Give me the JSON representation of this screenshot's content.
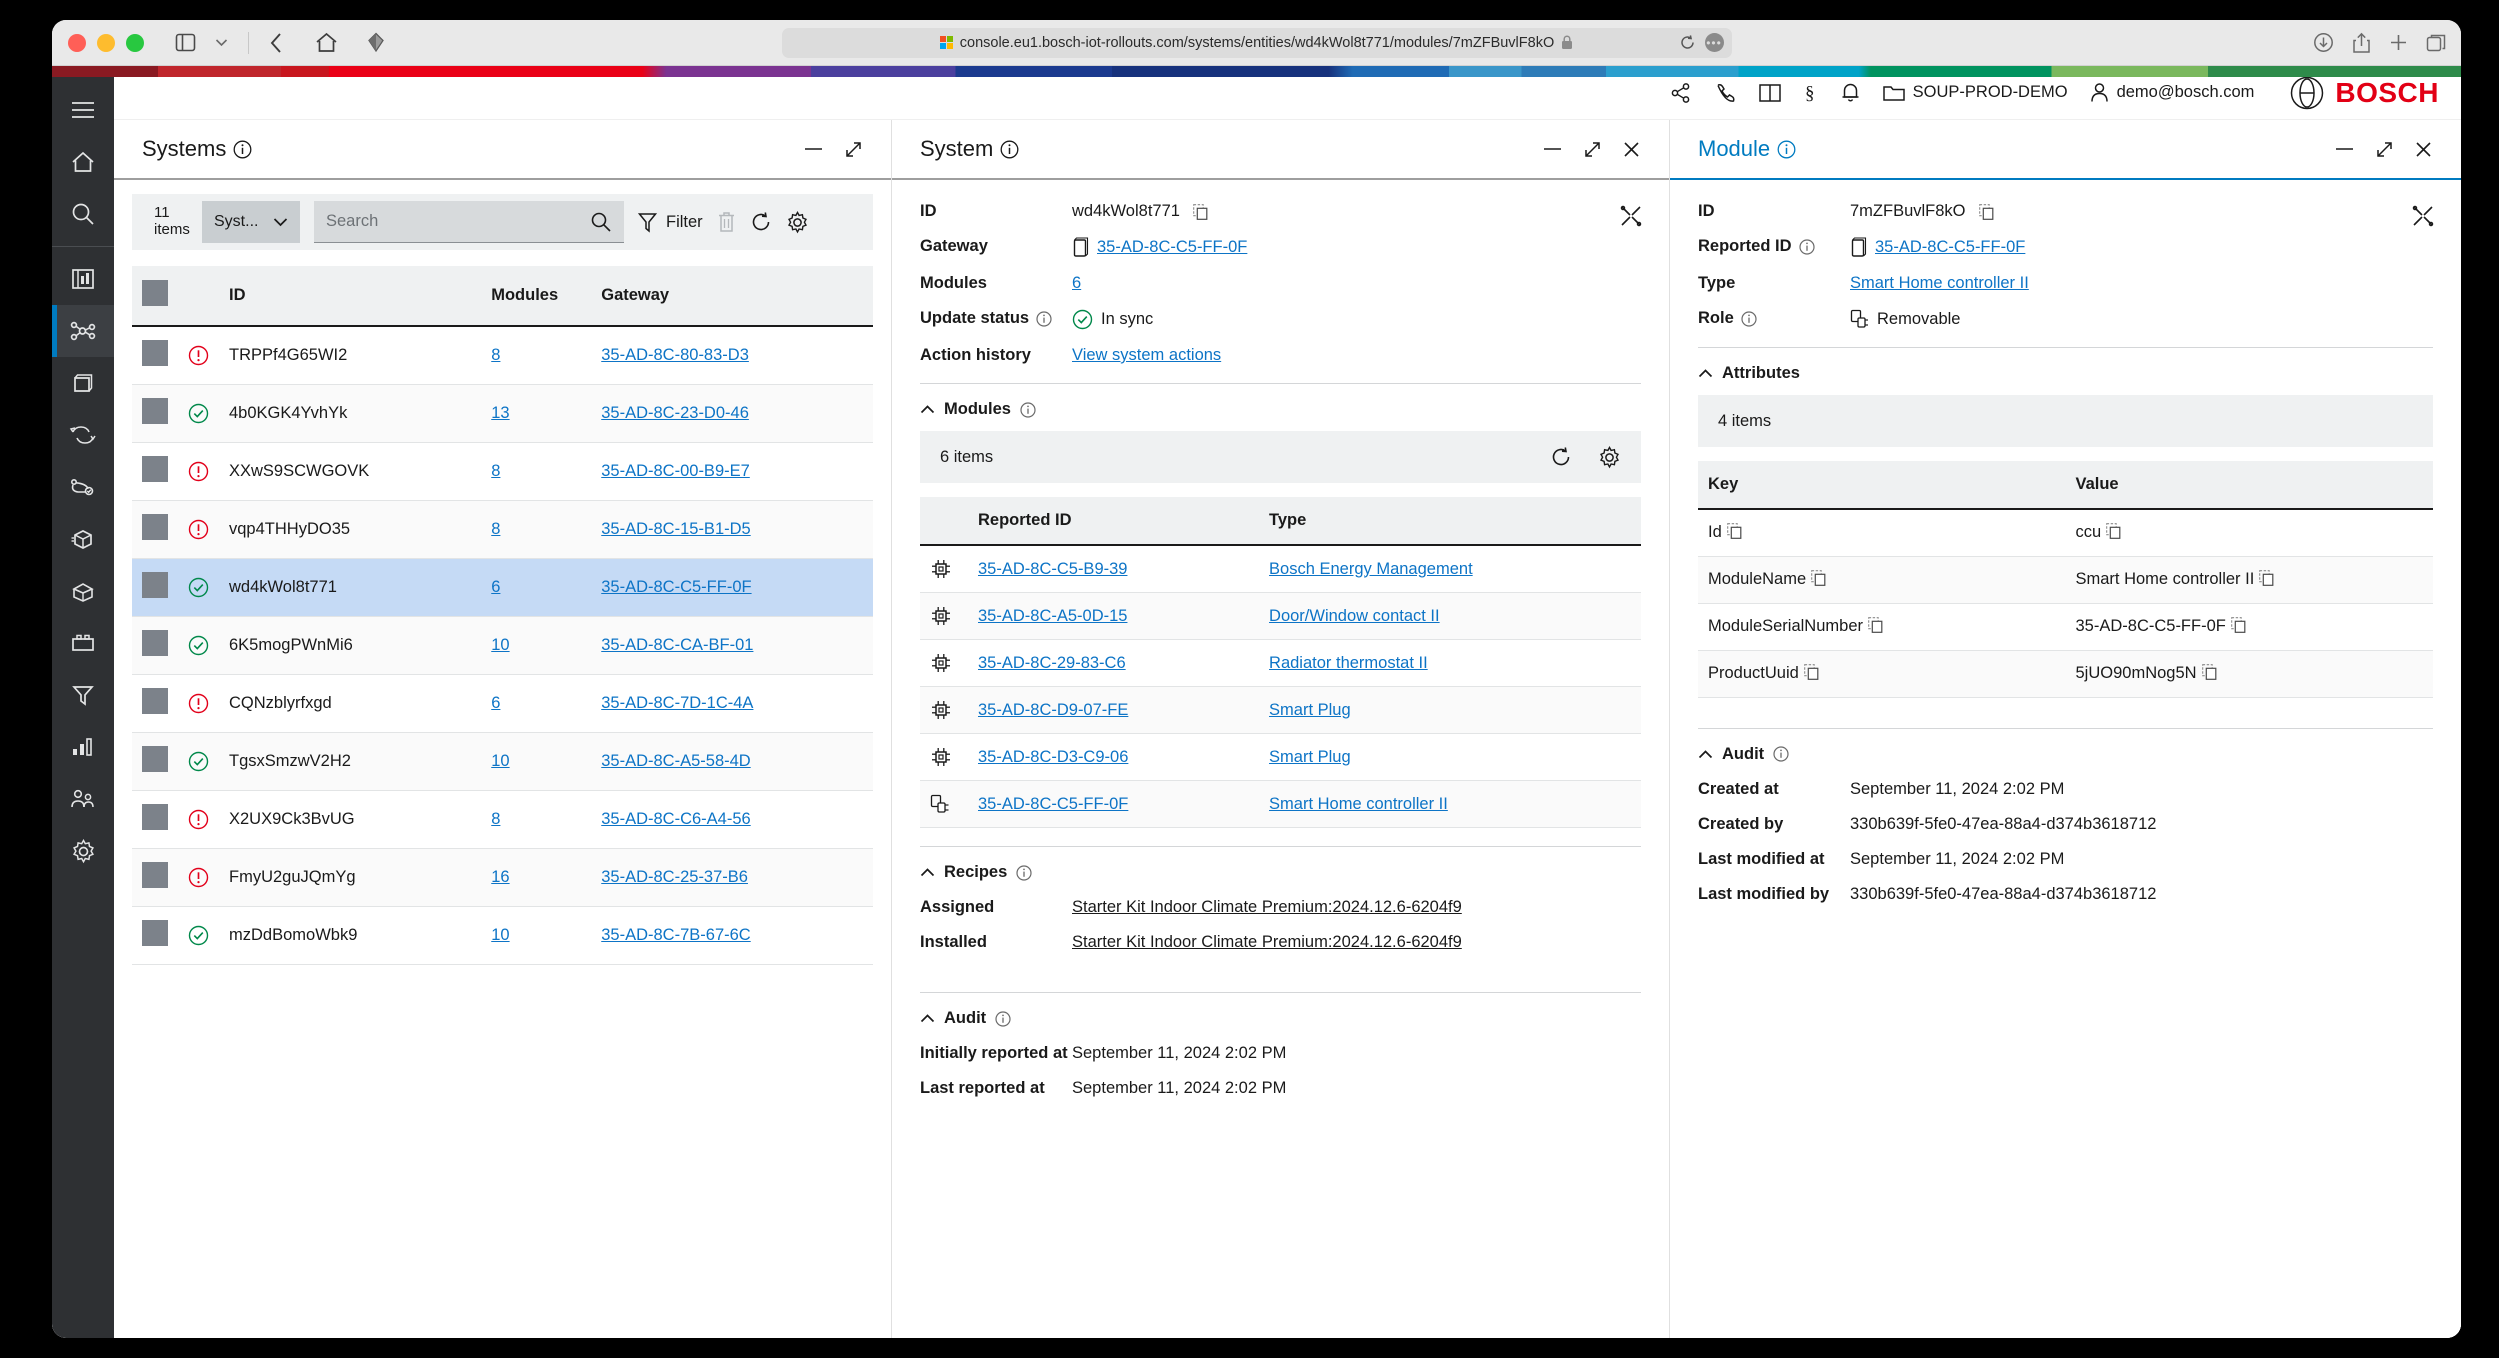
{
  "browser": {
    "url": "console.eu1.bosch-iot-rollouts.com/systems/entities/wd4kWol8t771/modules/7mZFBuvlF8kO",
    "lock_icon": "lock-icon",
    "back_icon": "back-icon",
    "home_icon": "home-icon",
    "sidebar_icon": "sidebar-toggle-icon",
    "extension_icon": "extension-icon",
    "reload_icon": "reload-icon",
    "more_icon": "more-icon",
    "download_icon": "download-icon",
    "share_icon": "share-icon",
    "newtab_icon": "new-tab-icon",
    "tabs_icon": "tab-overview-icon"
  },
  "rail": {
    "items": [
      {
        "icon": "hamburger-menu-icon",
        "name": "sidebar-item-menu"
      },
      {
        "icon": "home-icon",
        "name": "sidebar-item-home"
      },
      {
        "icon": "search-icon",
        "name": "sidebar-item-search"
      },
      {
        "icon": "dashboard-icon",
        "name": "sidebar-item-dashboard"
      },
      {
        "icon": "network-systems-icon",
        "name": "sidebar-item-systems"
      },
      {
        "icon": "device-icon",
        "name": "sidebar-item-devices"
      },
      {
        "icon": "sync-icon",
        "name": "sidebar-item-rollouts"
      },
      {
        "icon": "deployment-icon",
        "name": "sidebar-item-deployments"
      },
      {
        "icon": "package-icon",
        "name": "sidebar-item-packages"
      },
      {
        "icon": "open-package-icon",
        "name": "sidebar-item-software"
      },
      {
        "icon": "module-board-icon",
        "name": "sidebar-item-modules"
      },
      {
        "icon": "filter-icon",
        "name": "sidebar-item-filters"
      },
      {
        "icon": "chart-icon",
        "name": "sidebar-item-reports"
      },
      {
        "icon": "users-icon",
        "name": "sidebar-item-users"
      },
      {
        "icon": "gear-icon",
        "name": "sidebar-item-settings"
      }
    ]
  },
  "topbar": {
    "tenant": "SOUP-PROD-DEMO",
    "user": "demo@bosch.com",
    "brand": "BOSCH",
    "icons": [
      "share-icon",
      "phone-icon",
      "book-icon",
      "legal-icon",
      "bell-icon"
    ]
  },
  "systems_panel": {
    "title": "Systems",
    "minimize_label": "—",
    "items_count": "11 items",
    "type_select": "Syst...",
    "search_placeholder": "Search",
    "search_value": "",
    "filter_label": "Filter",
    "columns": [
      "ID",
      "Modules",
      "Gateway"
    ],
    "rows": [
      {
        "status": "error",
        "id": "TRPPf4G65WI2",
        "modules": "8",
        "gateway": "35-AD-8C-80-83-D3",
        "selected": false
      },
      {
        "status": "ok",
        "id": "4b0KGK4YvhYk",
        "modules": "13",
        "gateway": "35-AD-8C-23-D0-46",
        "selected": false
      },
      {
        "status": "error",
        "id": "XXwS9SCWGOVK",
        "modules": "8",
        "gateway": "35-AD-8C-00-B9-E7",
        "selected": false
      },
      {
        "status": "error",
        "id": "vqp4THHyDO35",
        "modules": "8",
        "gateway": "35-AD-8C-15-B1-D5",
        "selected": false
      },
      {
        "status": "ok",
        "id": "wd4kWol8t771",
        "modules": "6",
        "gateway": "35-AD-8C-C5-FF-0F",
        "selected": true
      },
      {
        "status": "ok",
        "id": "6K5mogPWnMi6",
        "modules": "10",
        "gateway": "35-AD-8C-CA-BF-01",
        "selected": false
      },
      {
        "status": "error",
        "id": "CQNzblyrfxgd",
        "modules": "6",
        "gateway": "35-AD-8C-7D-1C-4A",
        "selected": false
      },
      {
        "status": "ok",
        "id": "TgsxSmzwV2H2",
        "modules": "10",
        "gateway": "35-AD-8C-A5-58-4D",
        "selected": false
      },
      {
        "status": "error",
        "id": "X2UX9Ck3BvUG",
        "modules": "8",
        "gateway": "35-AD-8C-C6-A4-56",
        "selected": false
      },
      {
        "status": "error",
        "id": "FmyU2guJQmYg",
        "modules": "16",
        "gateway": "35-AD-8C-25-37-B6",
        "selected": false
      },
      {
        "status": "ok",
        "id": "mzDdBomoWbk9",
        "modules": "10",
        "gateway": "35-AD-8C-7B-67-6C",
        "selected": false
      }
    ]
  },
  "system_panel": {
    "title": "System",
    "fields": {
      "id_label": "ID",
      "id_value": "wd4kWol8t771",
      "gateway_label": "Gateway",
      "gateway_value": "35-AD-8C-C5-FF-0F",
      "modules_label": "Modules",
      "modules_value": "6",
      "update_status_label": "Update status",
      "update_status_value": "In sync",
      "action_history_label": "Action history",
      "action_history_link": "View system actions"
    },
    "modules_section": {
      "title": "Modules",
      "items_count": "6 items",
      "columns": [
        "Reported ID",
        "Type"
      ],
      "rows": [
        {
          "icon": "chip-icon",
          "reported_id": "35-AD-8C-C5-B9-39",
          "type": "Bosch Energy Management"
        },
        {
          "icon": "chip-icon",
          "reported_id": "35-AD-8C-A5-0D-15",
          "type": "Door/Window contact II"
        },
        {
          "icon": "chip-icon",
          "reported_id": "35-AD-8C-29-83-C6",
          "type": "Radiator thermostat II"
        },
        {
          "icon": "chip-icon",
          "reported_id": "35-AD-8C-D9-07-FE",
          "type": "Smart Plug"
        },
        {
          "icon": "chip-icon",
          "reported_id": "35-AD-8C-D3-C9-06",
          "type": "Smart Plug"
        },
        {
          "icon": "gateway-icon",
          "reported_id": "35-AD-8C-C5-FF-0F",
          "type": "Smart Home controller II"
        }
      ]
    },
    "recipes_section": {
      "title": "Recipes",
      "assigned_label": "Assigned",
      "assigned_value": "Starter Kit Indoor Climate Premium:2024.12.6-6204f9",
      "installed_label": "Installed",
      "installed_value": "Starter Kit Indoor Climate Premium:2024.12.6-6204f9"
    },
    "audit_section": {
      "title": "Audit",
      "initially_reported_label": "Initially reported at",
      "initially_reported_value": "September 11, 2024 2:02 PM",
      "last_reported_label": "Last reported at",
      "last_reported_value": "September 11, 2024 2:02 PM"
    }
  },
  "module_panel": {
    "title": "Module",
    "fields": {
      "id_label": "ID",
      "id_value": "7mZFBuvlF8kO",
      "reported_id_label": "Reported ID",
      "reported_id_value": "35-AD-8C-C5-FF-0F",
      "type_label": "Type",
      "type_value": "Smart Home controller II",
      "role_label": "Role",
      "role_value": "Removable"
    },
    "attributes_section": {
      "title": "Attributes",
      "items_count": "4 items",
      "columns": [
        "Key",
        "Value"
      ],
      "rows": [
        {
          "key": "Id",
          "value": "ccu"
        },
        {
          "key": "ModuleName",
          "value": "Smart Home controller II"
        },
        {
          "key": "ModuleSerialNumber",
          "value": "35-AD-8C-C5-FF-0F"
        },
        {
          "key": "ProductUuid",
          "value": "5jUO90mNog5N"
        }
      ]
    },
    "audit_section": {
      "title": "Audit",
      "created_at_label": "Created at",
      "created_at_value": "September 11, 2024 2:02 PM",
      "created_by_label": "Created by",
      "created_by_value": "330b639f-5fe0-47ea-88a4-d374b3618712",
      "last_modified_at_label": "Last modified at",
      "last_modified_at_value": "September 11, 2024 2:02 PM",
      "last_modified_by_label": "Last modified by",
      "last_modified_by_value": "330b639f-5fe0-47ea-88a4-d374b3618712"
    }
  },
  "colors": {
    "accent": "#007bc0",
    "brand_red": "#e20015",
    "ok_green": "#00884a",
    "error_red": "#e2001a",
    "link": "#0d74c6",
    "selected_row": "#c5daf5"
  }
}
